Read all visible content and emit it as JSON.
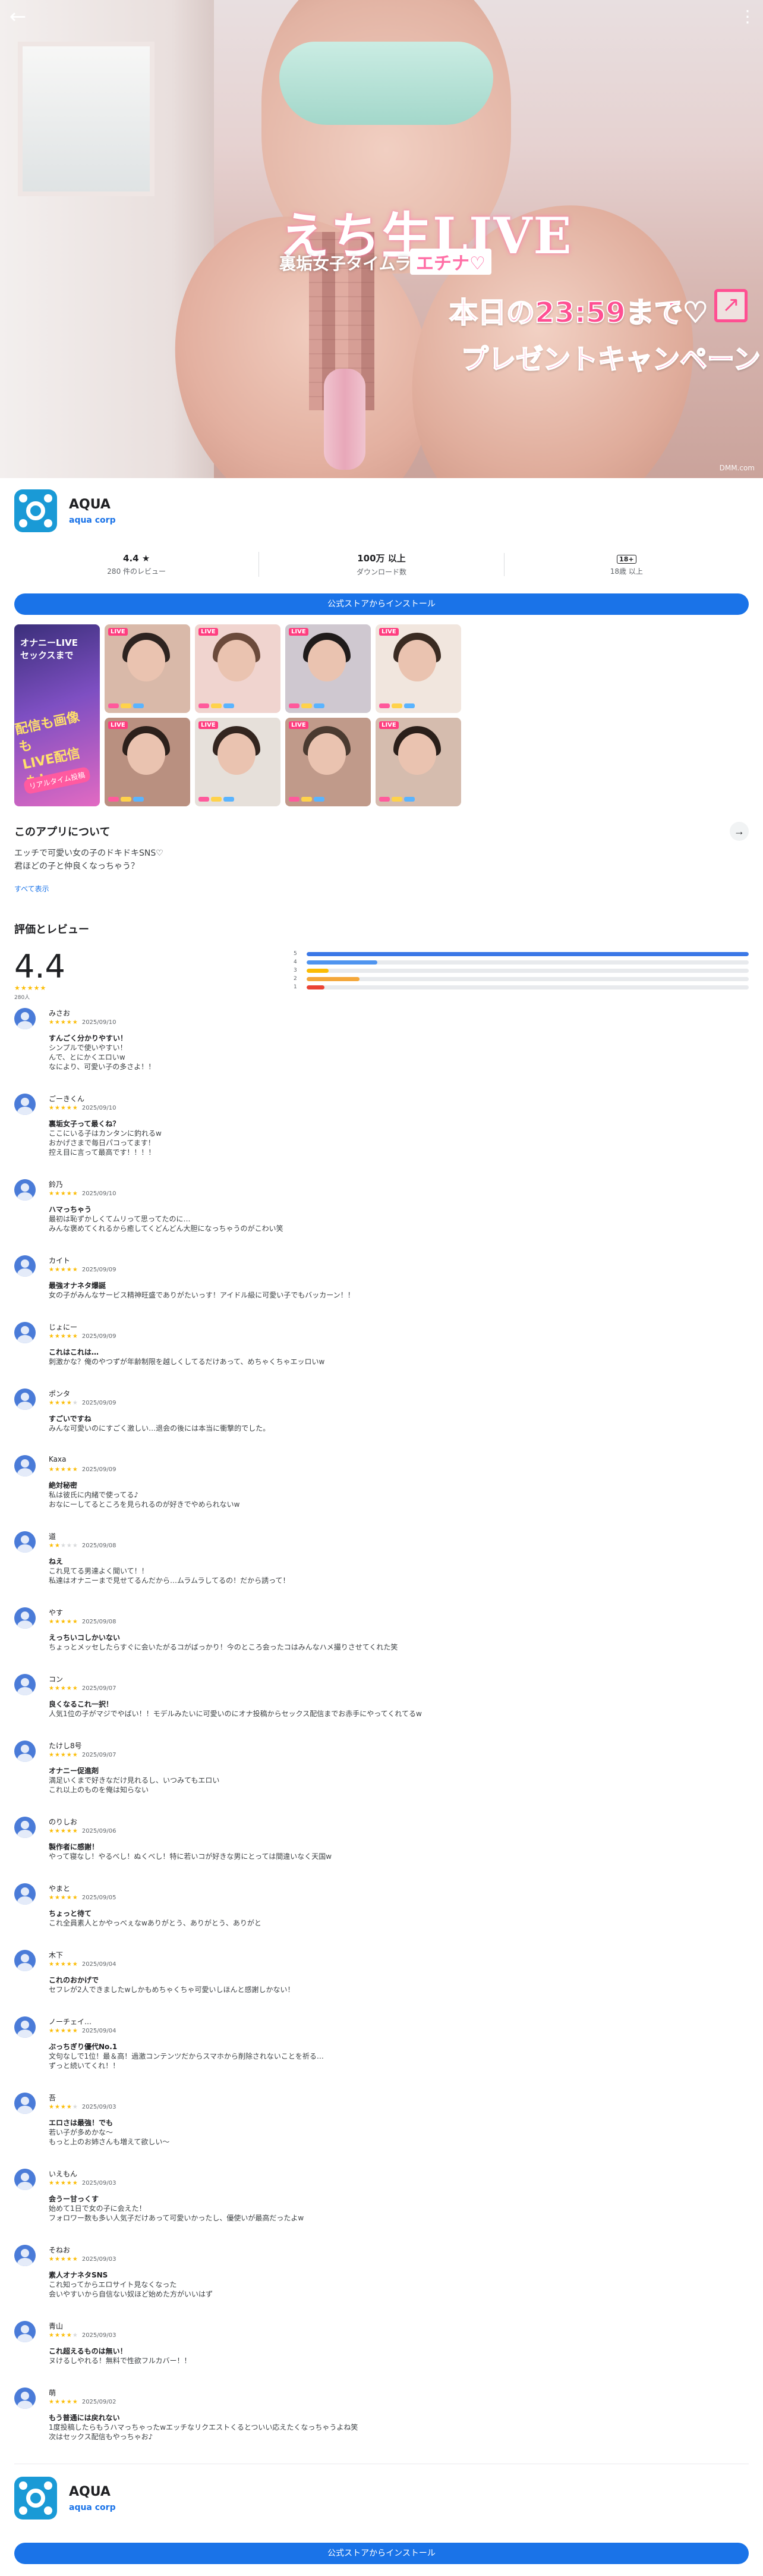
{
  "hero": {
    "back_icon": "arrow-back-icon",
    "more_icon": "more-vert-icon",
    "logo_title": "えち生LIVE",
    "logo_subtitle": "裏垢女子タイムライン",
    "logo_badge": "エチナ♡",
    "promo_line1": "本日の23:59まで♡",
    "promo_line2": "プレゼントキャンペーン",
    "promo_icon": "external-link-icon",
    "credit": "DMM.com"
  },
  "app": {
    "name": "AQUA",
    "developer": "aqua corp",
    "icon_color": "#1a9ad6"
  },
  "stats": {
    "rating_value": "4.4 ★",
    "rating_sub": "280 件のレビュー",
    "downloads_value": "100万 以上",
    "downloads_sub": "ダウンロード数",
    "age_value": "18+",
    "age_sub": "18歳 以上"
  },
  "install": {
    "label": "公式ストアからインストール"
  },
  "screenshots": {
    "big": {
      "line1": "オナニーLIVE\nセックスまで",
      "line2": "配信も画像も\nLIVE配信も!",
      "line3": "リアルタイム投稿"
    },
    "tiles": [
      {
        "badge": "LIVE",
        "bg": "#d9b9a9",
        "hair": "#2d2320"
      },
      {
        "badge": "LIVE",
        "bg": "#f0d4cf",
        "hair": "#6b4a3b"
      },
      {
        "badge": "LIVE",
        "bg": "#cfc8d0",
        "hair": "#1f1b1b"
      },
      {
        "badge": "LIVE",
        "bg": "#f1e6de",
        "hair": "#3a2b22"
      },
      {
        "badge": "LIVE",
        "bg": "#b99080",
        "hair": "#2c201b"
      },
      {
        "badge": "LIVE",
        "bg": "#e6e0da",
        "hair": "#33251f"
      },
      {
        "badge": "LIVE",
        "bg": "#c09a8a",
        "hair": "#4a3a30"
      },
      {
        "badge": "LIVE",
        "bg": "#d5bcae",
        "hair": "#2a1f1a"
      }
    ]
  },
  "about": {
    "title": "このアプリについて",
    "arrow_icon": "arrow-forward-icon",
    "text": "エッチで可愛い女の子のドキドキSNS♡\n君ほどの子と仲良くなっちゃう？",
    "see_all": "すべて表示"
  },
  "ratings": {
    "title": "評価とレビュー",
    "score": "4.4",
    "stars": "★★★★★",
    "count": "280人",
    "bars": [
      {
        "label": "5",
        "fraction": 1.0,
        "color": "#3b78e7"
      },
      {
        "label": "4",
        "fraction": 0.16,
        "color": "#4f94ef"
      },
      {
        "label": "3",
        "fraction": 0.05,
        "color": "#fbbc04"
      },
      {
        "label": "2",
        "fraction": 0.12,
        "color": "#f4a73a"
      },
      {
        "label": "1",
        "fraction": 0.04,
        "color": "#ea4335"
      }
    ]
  },
  "reviews": [
    {
      "user": "みさお",
      "stars": 5,
      "date": "2025/09/10",
      "title": "すんごく分かりやすい！",
      "text": "シンプルで使いやすい！\nんで、とにかくエロいw\nなにより、可愛い子の多さよ！！"
    },
    {
      "user": "ごーきくん",
      "stars": 5,
      "date": "2025/09/10",
      "title": "裏垢女子って最くね？",
      "text": "ここにいる子はカンタンに釣れるw\nおかげさまで毎日パコってます！\n控え目に言って最高です！！！！"
    },
    {
      "user": "鈴乃",
      "stars": 5,
      "date": "2025/09/10",
      "title": "ハマっちゃう",
      "text": "最初は恥ずかしくてムリって思ってたのに…\nみんな褒めてくれるから癒してくどんどん大胆になっちゃうのがこわい笑"
    },
    {
      "user": "カイト",
      "stars": 5,
      "date": "2025/09/09",
      "title": "最強オナネタ爆誕",
      "text": "女の子がみんなサービス精神旺盛でありがたいっす！アイドル級に可愛い子でもバッカーン！！"
    },
    {
      "user": "じょにー",
      "stars": 5,
      "date": "2025/09/09",
      "title": "これはこれは…",
      "text": "刺激かな？俺のやつずが年齢制限を越しくしてるだけあって、めちゃくちゃエッロいw"
    },
    {
      "user": "ポンタ",
      "stars": 4,
      "date": "2025/09/09",
      "title": "すごいですね",
      "text": "みんな可愛いのにすごく激しい…退会の後には本当に衝撃的でした。"
    },
    {
      "user": "Kaxa",
      "stars": 5,
      "date": "2025/09/09",
      "title": "絶対秘密",
      "text": "私は彼氏に内緒で使ってる♪\nおなにーしてるところを見られるのが好きでやめられないw"
    },
    {
      "user": "道",
      "stars": 2,
      "date": "2025/09/08",
      "title": "ねえ",
      "text": "これ見てる男達よく聞いて！！\n私達はオナニーまで見せてるんだから…ムラムラしてるの！だから誘って！"
    },
    {
      "user": "やす",
      "stars": 5,
      "date": "2025/09/08",
      "title": "えっちいコしかいない",
      "text": "ちょっとメッセしたらすぐに会いたがるコがばっかり！今のところ会ったコはみんなハメ撮りさせてくれた笑"
    },
    {
      "user": "コン",
      "stars": 5,
      "date": "2025/09/07",
      "title": "良くなるこれ一択！",
      "text": "人気1位の子がマジでやばい！！モデルみたいに可愛いのにオナ投稿からセックス配信までお赤手にやってくれてるw"
    },
    {
      "user": "たけし8号",
      "stars": 5,
      "date": "2025/09/07",
      "title": "オナニー促進剤",
      "text": "満足いくまで好きなだけ見れるし、いつみてもエロい\nこれ以上のものを俺は知らない"
    },
    {
      "user": "のりしお",
      "stars": 5,
      "date": "2025/09/06",
      "title": "製作者に感謝！",
      "text": "やって寝なし！やるべし！ぬくべし！特に若いコが好きな男にとっては間違いなく天国w"
    },
    {
      "user": "やまと",
      "stars": 5,
      "date": "2025/09/05",
      "title": "ちょっと待て",
      "text": "これ全員素人とかやっべぇなwありがとう、ありがとう、ありがと"
    },
    {
      "user": "木下",
      "stars": 5,
      "date": "2025/09/04",
      "title": "これのおかげで",
      "text": "セフレが2人できましたwしかもめちゃくちゃ可愛いしほんと感謝しかない！"
    },
    {
      "user": "ノーチェイ…",
      "stars": 5,
      "date": "2025/09/04",
      "title": "ぶっちぎり優代No.1",
      "text": "文句なしで1位！最＆高！過激コンテンツだからスマホから削除されないことを祈る…\nずっと続いてくれ！！"
    },
    {
      "user": "吾",
      "stars": 4,
      "date": "2025/09/03",
      "title": "エロさは最強！でも",
      "text": "若い子が多めかな～\nもっと上のお姉さんも増えて欲しい～"
    },
    {
      "user": "いえもん",
      "stars": 5,
      "date": "2025/09/03",
      "title": "会うー甘っくす",
      "text": "始めて1日で女の子に会えた！\nフォロワー数も多い人気子だけあって可愛いかったし、優使いが最高だったよw"
    },
    {
      "user": "そねお",
      "stars": 5,
      "date": "2025/09/03",
      "title": "素人オナネタSNS",
      "text": "これ知ってからエロサイト見なくなった\n会いやすいから自信ない奴ほど始めた方がいいはず"
    },
    {
      "user": "青山",
      "stars": 4,
      "date": "2025/09/03",
      "title": "これ超えるものは無い！",
      "text": "ヌけるしやれる！無料で性欲フルカバー！！"
    },
    {
      "user": "萌",
      "stars": 5,
      "date": "2025/09/02",
      "title": "もう普通には戻れない",
      "text": "1度投稿したらもうハマっちゃったwエッチなリクエストくるとついい応えたくなっちゃうよね笑\n次はセックス配信もやっちゃお♪"
    }
  ],
  "footer": {
    "name": "AQUA",
    "developer": "aqua corp",
    "install_label": "公式ストアからインストール"
  }
}
